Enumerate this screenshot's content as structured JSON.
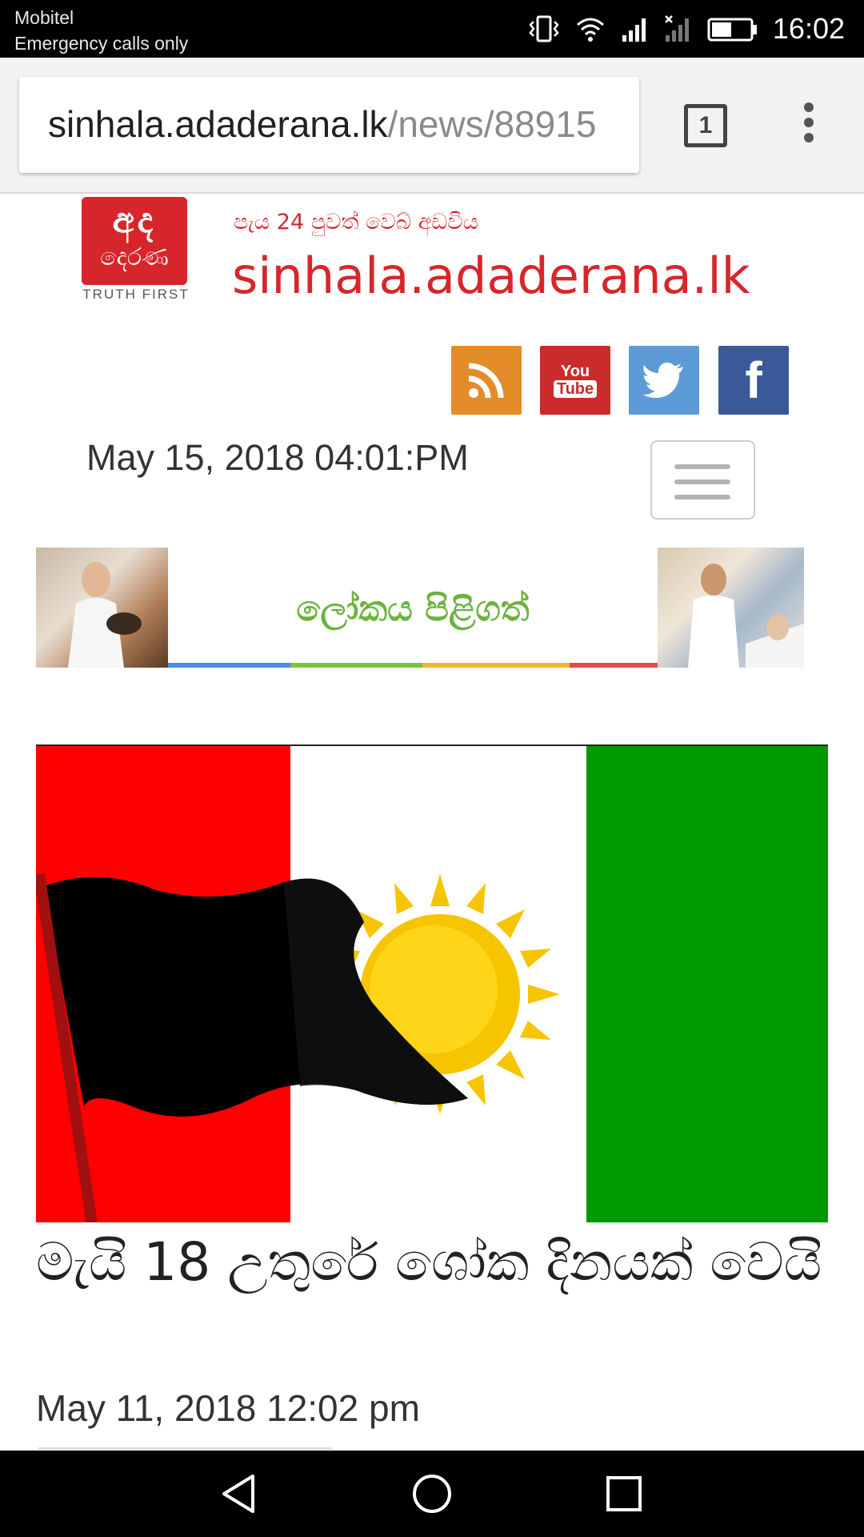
{
  "status_bar": {
    "carrier": "Mobitel",
    "carrier_status": "Emergency calls only",
    "time": "16:02",
    "icons": [
      "vibrate-icon",
      "wifi-icon",
      "signal-icon",
      "no-signal-icon",
      "battery-icon"
    ]
  },
  "browser": {
    "url_host": "sinhala.adaderana.lk",
    "url_path": "/news/88915",
    "tab_count": "1",
    "menu_icon": "more-vert-icon"
  },
  "site_header": {
    "logo_text_1": "අද",
    "logo_text_2": "දෙරණ",
    "logo_tagline": "TRUTH FIRST",
    "tagline": "පැය 24 පුවත් වෙබ් අඩවිය",
    "site_name": "sinhala.adaderana.lk",
    "social": [
      "rss-icon",
      "youtube-icon",
      "twitter-icon",
      "facebook-icon"
    ],
    "youtube_you": "You",
    "youtube_tube": "Tube",
    "facebook_glyph": "f",
    "date": "May 15, 2018  04:01:PM"
  },
  "ad": {
    "text": "ලෝකය පිළිගත්"
  },
  "article": {
    "title": "මැයි 18 උතුරේ ශෝක දිනයක් වෙයි",
    "date": "May 11, 2018  12:02 pm"
  },
  "colors": {
    "brand_red": "#d7262b",
    "ad_green": "#6cb33f",
    "flag_red": "#ff0000",
    "flag_green": "#009900",
    "sun_yellow": "#f7c400"
  }
}
